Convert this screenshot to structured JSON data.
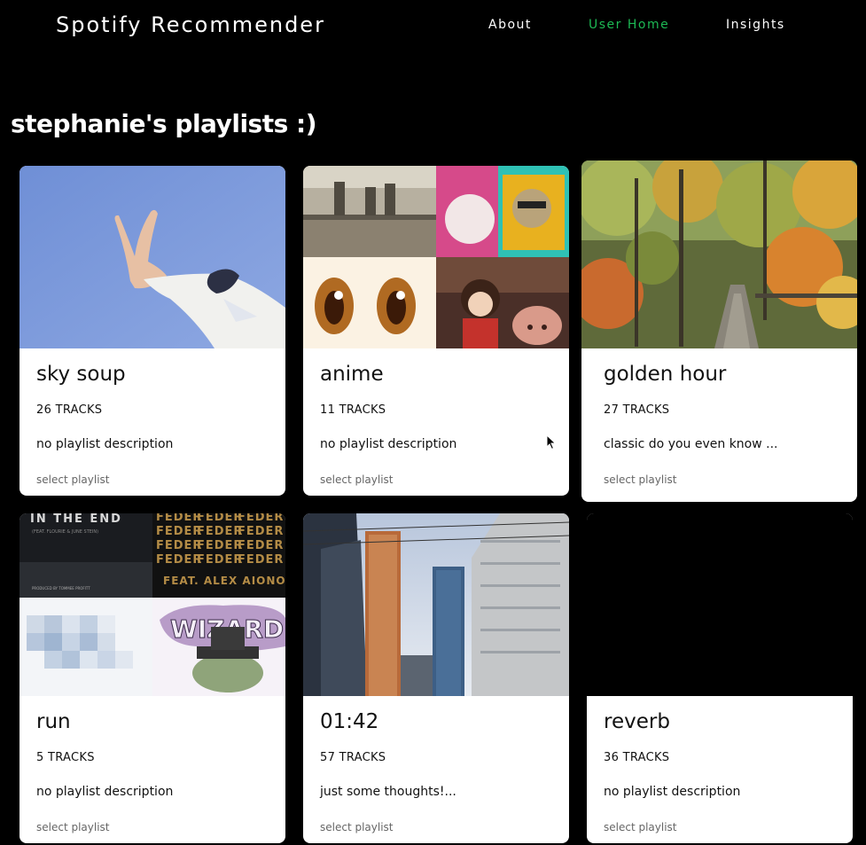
{
  "nav": {
    "brand": "Spotify Recommender",
    "links": [
      {
        "label": "About",
        "active": false
      },
      {
        "label": "User Home",
        "active": true
      },
      {
        "label": "Insights",
        "active": false
      }
    ]
  },
  "page": {
    "title": "stephanie's playlists :)"
  },
  "playlists": [
    {
      "name": "sky soup",
      "tracks": "26 TRACKS",
      "description": "no playlist description",
      "action": "select playlist"
    },
    {
      "name": "anime",
      "tracks": "11 TRACKS",
      "description": "no playlist description",
      "action": "select playlist"
    },
    {
      "name": "golden hour",
      "tracks": "27 TRACKS",
      "description": "classic do you even know ...",
      "action": "select playlist"
    },
    {
      "name": "run",
      "tracks": "5 TRACKS",
      "description": "no playlist description",
      "action": "select playlist"
    },
    {
      "name": "01:42",
      "tracks": "57 TRACKS",
      "description": "just some thoughts!...",
      "action": "select playlist"
    },
    {
      "name": "reverb",
      "tracks": "36 TRACKS",
      "description": "no playlist description",
      "action": "select playlist"
    }
  ],
  "cover_art": {
    "run_tile_top_left": "IN THE END",
    "run_tile_top_left_credit": "(FEAT. FLOURIE & JUNE STEIN)",
    "run_tile_top_left_producer": "PRODUCED BY TOMMEE PROFITT",
    "run_tile_top_right_word": "FEDER",
    "run_tile_top_right_feat": "FEAT. ALEX AIONO",
    "run_tile_bottom_right": "WIZARD"
  },
  "colors": {
    "background": "#000000",
    "accent": "#1db954",
    "card": "#ffffff"
  }
}
